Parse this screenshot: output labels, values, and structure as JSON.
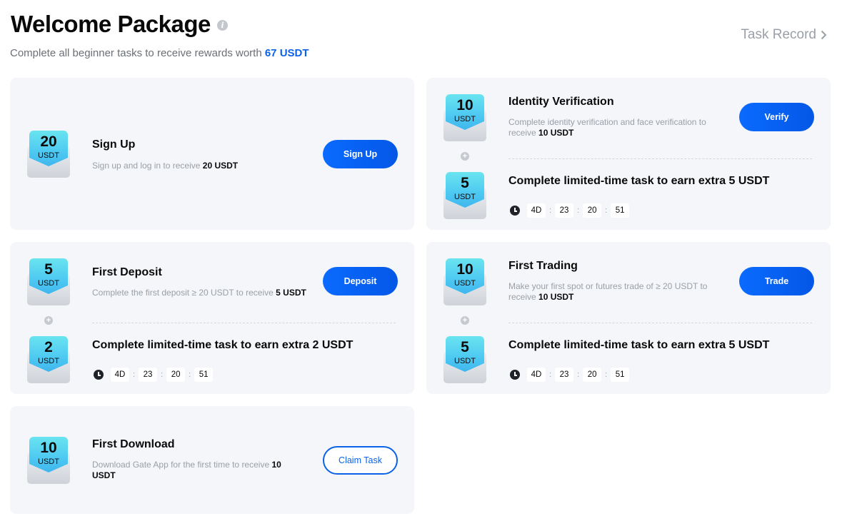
{
  "header": {
    "title": "Welcome Package",
    "info_icon": "info-icon",
    "subtitle_prefix": "Complete all beginner tasks to receive rewards worth ",
    "subtitle_amount": "67 USDT",
    "task_record_label": "Task Record",
    "task_record_icon": "chevron-right-icon"
  },
  "colors": {
    "accent": "#0b62e8",
    "card_bg": "#f4f6f9",
    "badge_cyan": "#4fcbf2"
  },
  "tasks": {
    "signup": {
      "badge_value": "20",
      "badge_unit": "USDT",
      "title": "Sign Up",
      "desc_prefix": "Sign up and log in to receive ",
      "desc_amount": "20 USDT",
      "button": "Sign Up"
    },
    "identity": {
      "badge_value": "10",
      "badge_unit": "USDT",
      "title": "Identity Verification",
      "desc_prefix": "Complete identity verification and face verification to receive ",
      "desc_amount": "10 USDT",
      "button": "Verify",
      "extra": {
        "badge_value": "5",
        "badge_unit": "USDT",
        "title": "Complete limited-time task to earn extra 5 USDT",
        "timer": [
          "4D",
          "23",
          "20",
          "51"
        ]
      }
    },
    "deposit": {
      "badge_value": "5",
      "badge_unit": "USDT",
      "title": "First Deposit",
      "desc_prefix": "Complete the first deposit ≥ 20 USDT to receive ",
      "desc_amount": "5 USDT",
      "button": "Deposit",
      "extra": {
        "badge_value": "2",
        "badge_unit": "USDT",
        "title": "Complete limited-time task to earn extra 2 USDT",
        "timer": [
          "4D",
          "23",
          "20",
          "51"
        ]
      }
    },
    "trading": {
      "badge_value": "10",
      "badge_unit": "USDT",
      "title": "First Trading",
      "desc_prefix": "Make your first spot or futures trade of ≥ 20 USDT to receive ",
      "desc_amount": "10 USDT",
      "button": "Trade",
      "extra": {
        "badge_value": "5",
        "badge_unit": "USDT",
        "title": "Complete limited-time task to earn extra 5 USDT",
        "timer": [
          "4D",
          "23",
          "20",
          "51"
        ]
      }
    },
    "download": {
      "badge_value": "10",
      "badge_unit": "USDT",
      "title": "First Download",
      "desc_prefix": "Download Gate App for the first time to receive ",
      "desc_amount": "10 USDT",
      "button": "Claim Task"
    }
  },
  "timer_separator": ":"
}
